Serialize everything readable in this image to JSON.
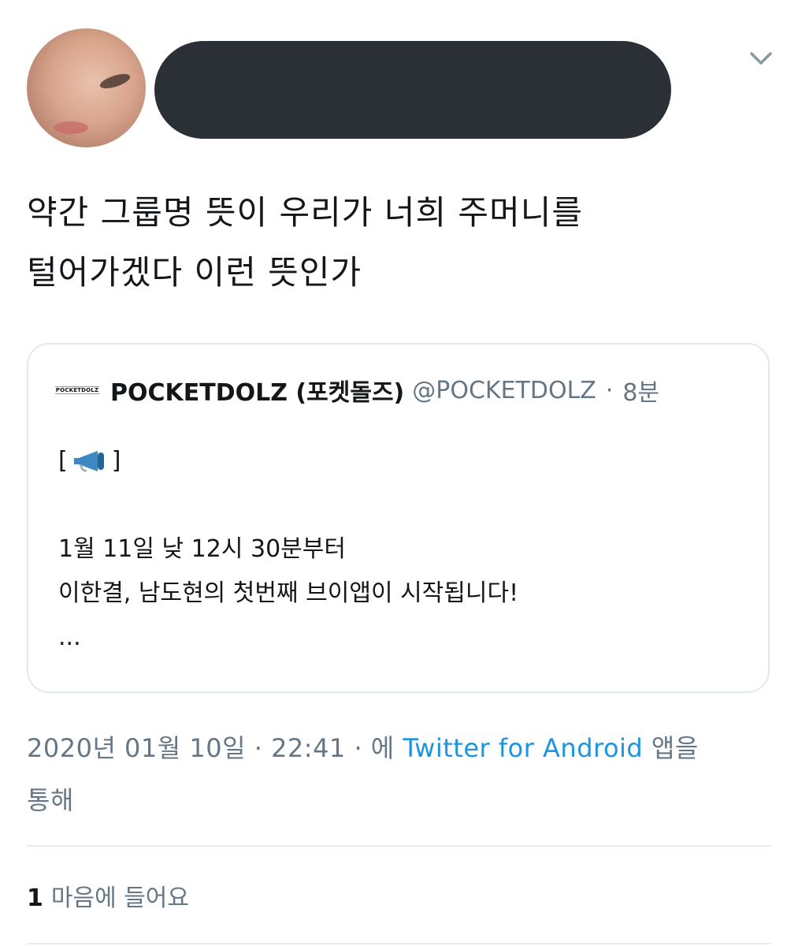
{
  "author": {
    "avatar_icon": "profile-photo",
    "name_redacted": true
  },
  "menu_icon": "chevron-down-icon",
  "tweet": {
    "text_lines": [
      "약간 그룹명 뜻이 우리가 너희 주머니를",
      "털어가겠다 이런 뜻인가"
    ]
  },
  "quoted_tweet": {
    "avatar_label": "POCKETDOLZ",
    "name": "POCKETDOLZ (포켓돌즈)",
    "handle": "@POCKETDOLZ",
    "separator": "·",
    "time": "8분",
    "announcement_open": "[",
    "announcement_icon": "megaphone-icon",
    "announcement_close": "]",
    "line1": "1월 11일 낮 12시 30분부터",
    "line2": "이한결, 남도현의 첫번째 브이앱이 시작됩니다!",
    "ellipsis": "..."
  },
  "meta": {
    "date": "2020년 01월 10일",
    "separator": "·",
    "time": "22:41",
    "prefix": "에",
    "source": "Twitter for Android",
    "suffix": "앱을",
    "suffix2": "통해"
  },
  "likes": {
    "count": "1",
    "label": "마음에 들어요"
  },
  "colors": {
    "text": "#14171a",
    "secondary": "#657786",
    "link": "#1b95e0",
    "border": "#e1e8ed"
  }
}
